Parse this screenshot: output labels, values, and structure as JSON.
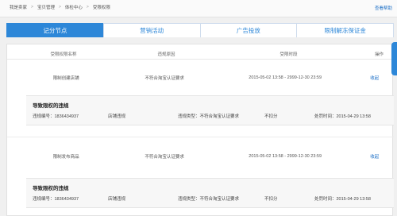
{
  "breadcrumb": [
    "我是卖家",
    "宝贝管理",
    "体检中心",
    "受限权限"
  ],
  "topbar_more": "查看帮助",
  "tabs": [
    {
      "label": "记分节点",
      "active": true
    },
    {
      "label": "营销活动",
      "active": false
    },
    {
      "label": "广告投放",
      "active": false
    },
    {
      "label": "限制解冻保证金",
      "active": false
    }
  ],
  "table": {
    "headers": [
      "受限权限名称",
      "违规原因",
      "受限时段",
      "操作"
    ],
    "rows": [
      {
        "name": "限制创建店铺",
        "reason": "不符合淘宝认证要求",
        "period": "2015-05-02 13:58 - 2999-12-30 23:59",
        "action": "收起",
        "detail": {
          "title": "导致限权的违规",
          "id": "违规编号：1836434937",
          "scene": "店铺违规",
          "type": "违规类型：不符合淘宝认证要求",
          "score": "不扣分",
          "time": "处罚时间：2015-04-29 13:58"
        }
      },
      {
        "name": "限制发布商品",
        "reason": "不符合淘宝认证要求",
        "period": "2015-05-02 13:58 - 2999-12-30 23:59",
        "action": "收起",
        "detail": {
          "title": "导致限权的违规",
          "id": "违规编号：1836434937",
          "scene": "店铺违规",
          "type": "违规类型：不符合淘宝认证要求",
          "score": "不扣分",
          "time": "处罚时间：2015-04-29 13:58"
        }
      }
    ]
  },
  "colors": {
    "accent": "#2d87d8",
    "link": "#1a6ec6"
  }
}
